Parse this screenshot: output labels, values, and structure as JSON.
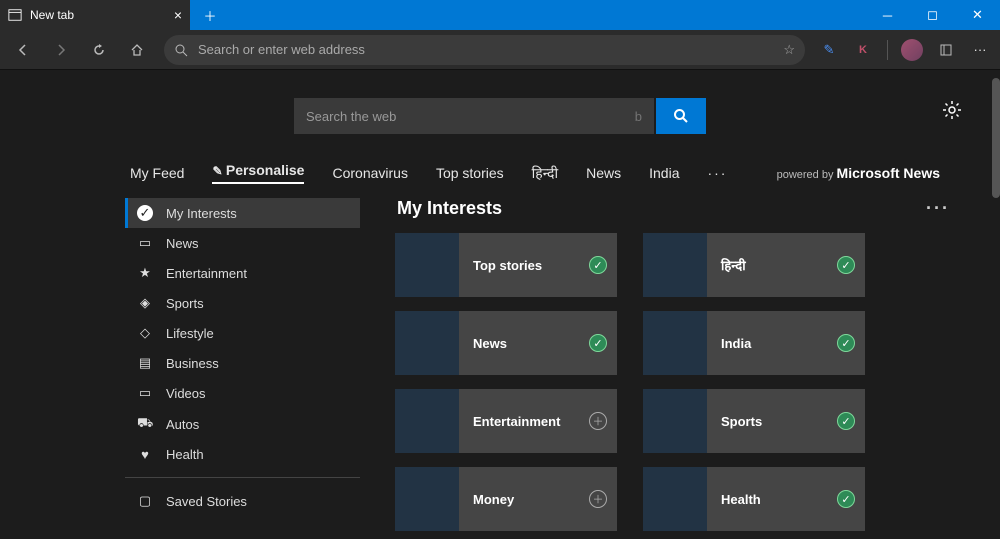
{
  "titlebar": {
    "tab_label": "New tab"
  },
  "toolbar": {
    "omnibox_placeholder": "Search or enter web address",
    "profile_letter": "K"
  },
  "ntp": {
    "search_placeholder": "Search the web",
    "nav": [
      "My Feed",
      "Personalise",
      "Coronavirus",
      "Top stories",
      "हिन्दी",
      "News",
      "India"
    ],
    "nav_more": "···",
    "powered_prefix": "powered by ",
    "powered_brand": "Microsoft News"
  },
  "sidebar": {
    "items": [
      {
        "label": "My Interests",
        "icon": "✓",
        "selected": true
      },
      {
        "label": "News",
        "icon": "▭"
      },
      {
        "label": "Entertainment",
        "icon": "★"
      },
      {
        "label": "Sports",
        "icon": "◈"
      },
      {
        "label": "Lifestyle",
        "icon": "◇"
      },
      {
        "label": "Business",
        "icon": "▤"
      },
      {
        "label": "Videos",
        "icon": "▭"
      },
      {
        "label": "Autos",
        "icon": "⛟"
      },
      {
        "label": "Health",
        "icon": "♥"
      }
    ],
    "saved_label": "Saved Stories",
    "saved_icon": "▢"
  },
  "panel": {
    "title": "My Interests",
    "cards": [
      {
        "label": "Top stories",
        "state": "on",
        "thumb": "th1"
      },
      {
        "label": "हिन्दी",
        "state": "on",
        "thumb": "th2"
      },
      {
        "label": "News",
        "state": "on",
        "thumb": "th3"
      },
      {
        "label": "India",
        "state": "on",
        "thumb": "th4"
      },
      {
        "label": "Entertainment",
        "state": "off",
        "thumb": "th5"
      },
      {
        "label": "Sports",
        "state": "on",
        "thumb": "th6"
      },
      {
        "label": "Money",
        "state": "off",
        "thumb": "th7"
      },
      {
        "label": "Health",
        "state": "on",
        "thumb": "th8"
      }
    ]
  }
}
